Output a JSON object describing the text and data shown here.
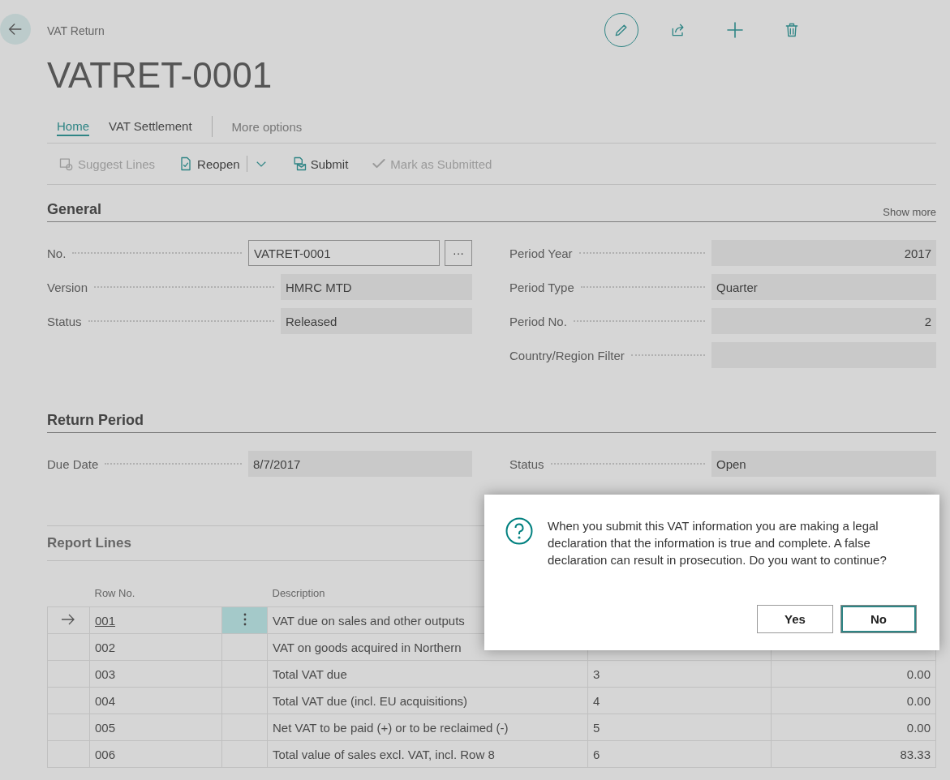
{
  "breadcrumb": "VAT Return",
  "title": "VATRET-0001",
  "tabs": [
    {
      "label": "Home",
      "selected": true
    },
    {
      "label": "VAT Settlement",
      "selected": false
    }
  ],
  "more_options": "More options",
  "actions": [
    {
      "label": "Suggest Lines",
      "disabled": true,
      "has_menu": false
    },
    {
      "label": "Reopen",
      "disabled": false,
      "has_menu": true
    },
    {
      "label": "Submit",
      "disabled": false,
      "has_menu": false
    },
    {
      "label": "Mark as Submitted",
      "disabled": true,
      "has_menu": false
    }
  ],
  "general": {
    "title": "General",
    "show_more": "Show more",
    "left_fields": [
      {
        "label": "No.",
        "value": "VATRET-0001",
        "kind": "lookup",
        "lookup": "···"
      },
      {
        "label": "Version",
        "value": "HMRC MTD",
        "kind": "text"
      },
      {
        "label": "Status",
        "value": "Released",
        "kind": "text"
      }
    ],
    "right_fields": [
      {
        "label": "Period Year",
        "value": "2017",
        "kind": "number"
      },
      {
        "label": "Period Type",
        "value": "Quarter",
        "kind": "text"
      },
      {
        "label": "Period No.",
        "value": "2",
        "kind": "number"
      },
      {
        "label": "Country/Region Filter",
        "kind": "text"
      }
    ]
  },
  "return_period": {
    "title": "Return Period",
    "left_fields": [
      {
        "label": "Due Date",
        "value": "8/7/2017"
      }
    ],
    "right_fields": [
      {
        "label": "Status",
        "value": "Open"
      }
    ]
  },
  "report_lines": {
    "title": "Report Lines",
    "columns": [
      "Row No.",
      "Description"
    ],
    "rows": [
      {
        "row_no": "001",
        "description": "VAT due on sales and other outputs",
        "selected": true
      },
      {
        "row_no": "002",
        "description": "VAT on goods acquired in Northern",
        "selected": false
      },
      {
        "row_no": "003",
        "description": "Total VAT due",
        "column_4": "3",
        "column_5": "0.00",
        "selected": false
      },
      {
        "row_no": "004",
        "description": "Total VAT due (incl. EU acquisitions)",
        "column_4": "4",
        "column_5": "0.00",
        "selected": false
      },
      {
        "row_no": "005",
        "description": "Net VAT to be paid (+) or to be reclaimed (-)",
        "column_4": "5",
        "column_5": "0.00",
        "selected": false
      },
      {
        "row_no": "006",
        "description": "Total value of sales excl. VAT, incl. Row 8",
        "column_4": "6",
        "column_5": "83.33",
        "selected": false
      }
    ]
  },
  "dialog": {
    "message": "When you submit this VAT information you are making a legal declaration that the information is true and complete. A false declaration can result in prosecution. Do you want to continue?",
    "buttons": [
      {
        "label": "Yes",
        "focused": false
      },
      {
        "label": "No",
        "focused": true
      }
    ]
  }
}
